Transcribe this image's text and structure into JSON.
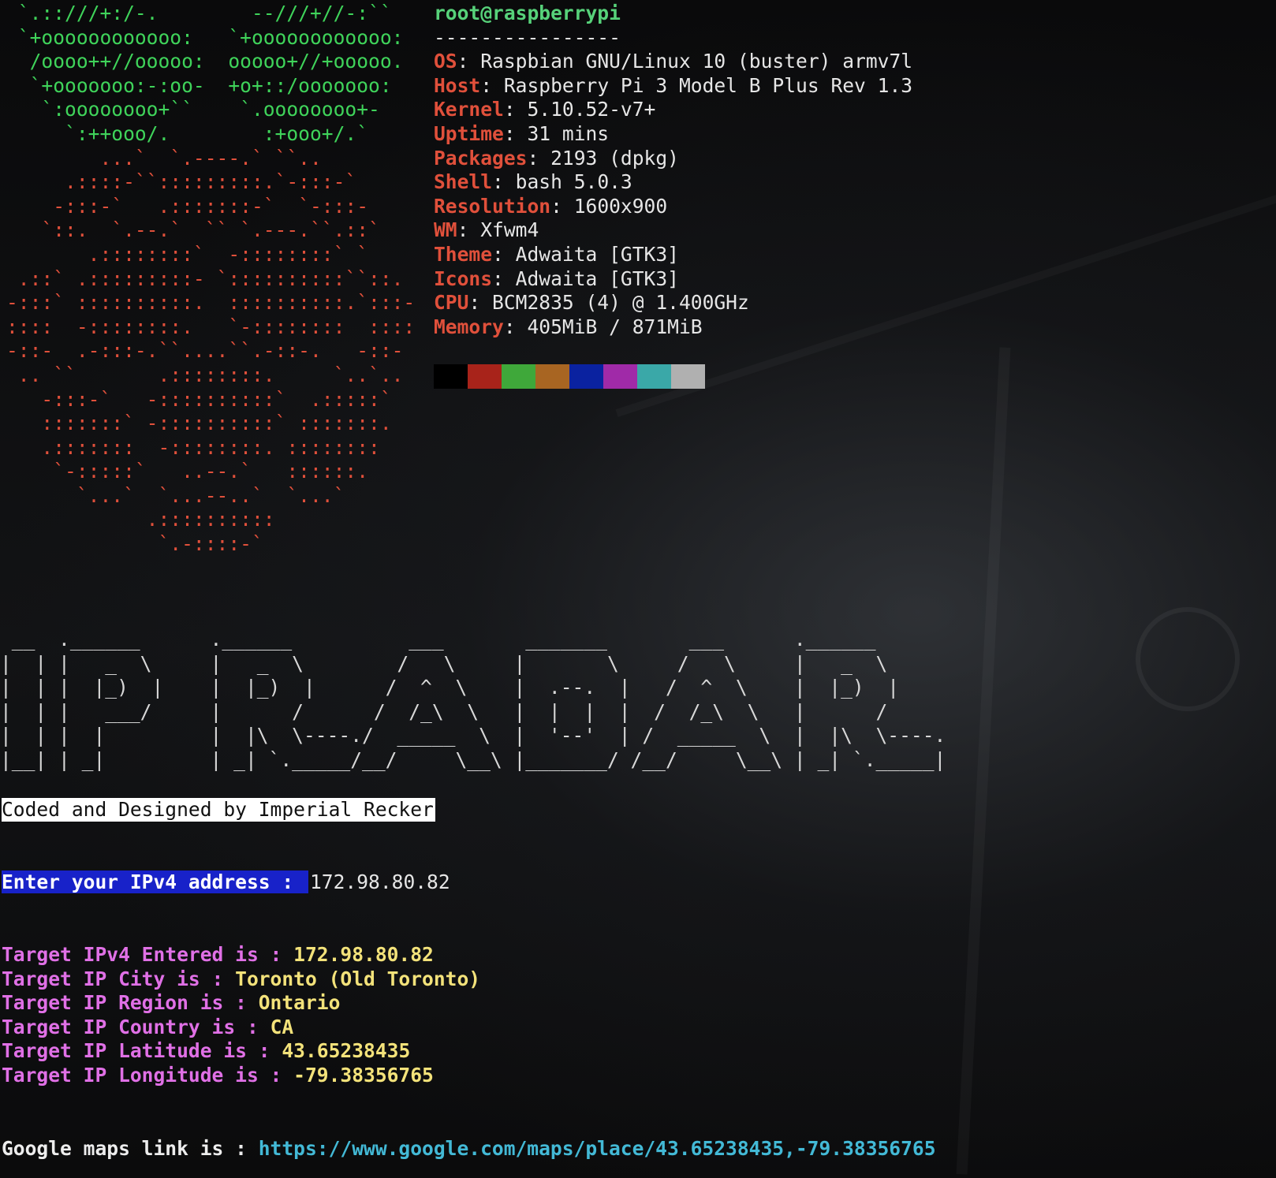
{
  "colors": {
    "background": "#0b0b0c",
    "logo_green": "#3fd35a",
    "logo_red": "#e0503b",
    "info_key": "#e0503b",
    "user_host": "#57d27a",
    "prompt_bg": "#1822c9",
    "result_label": "#e070e6",
    "result_value": "#f3e27a",
    "link": "#43b9d6"
  },
  "neofetch": {
    "logo_leaves": " `.::///+:/-.        --///+//-:``\n `+oooooooooooo:   `+oooooooooooo:\n  /oooo++//ooooo:  ooooo+//+ooooo.\n  `+ooooooo:-:oo-  +o+::/ooooooo:\n   `:oooooooo+``    `.oooooooo+-\n     `:++ooo/.        :+ooo+/.`",
    "logo_berry": "        ...`  `.----.` ``..\n     .::::-``:::::::::.`-:::-`\n    -:::-`   .:::::::-`  `-:::-\n   `::.  `.--.`  `` `.---.``.::`\n       .::::::::`  -::::::::` `\n .::` .:::::::::- `::::::::::``::.\n-:::` ::::::::::.  ::::::::::.`:::-\n::::  -::::::::.   `-::::::::  ::::\n-::-  .-:::-.``....``.-::-.   -::-\n .. ``       .::::::::.     `..`..\n   -:::-`   -::::::::::`  .:::::`\n   :::::::` -::::::::::` :::::::.\n   .:::::::  -::::::::. ::::::::\n    `-:::::`   ..--.`   ::::::.\n      `...`  `...--..`  `...`\n            .::::::::::\n             `.-::::-`",
    "user_host": "root@raspberrypi",
    "separator": "----------------",
    "fields": [
      {
        "key": "OS",
        "value": "Raspbian GNU/Linux 10 (buster) armv7l"
      },
      {
        "key": "Host",
        "value": "Raspberry Pi 3 Model B Plus Rev 1.3"
      },
      {
        "key": "Kernel",
        "value": "5.10.52-v7+"
      },
      {
        "key": "Uptime",
        "value": "31 mins"
      },
      {
        "key": "Packages",
        "value": "2193 (dpkg)"
      },
      {
        "key": "Shell",
        "value": "bash 5.0.3"
      },
      {
        "key": "Resolution",
        "value": "1600x900"
      },
      {
        "key": "WM",
        "value": "Xfwm4"
      },
      {
        "key": "Theme",
        "value": "Adwaita [GTK3]"
      },
      {
        "key": "Icons",
        "value": "Adwaita [GTK3]"
      },
      {
        "key": "CPU",
        "value": "BCM2835 (4) @ 1.400GHz"
      },
      {
        "key": "Memory",
        "value": "405MiB / 871MiB"
      }
    ],
    "palette": [
      "#000000",
      "#a8231a",
      "#3fa83a",
      "#a86522",
      "#0a22a0",
      "#a02aa8",
      "#3aa8a8",
      "#b0b0b0"
    ]
  },
  "banner": {
    "art": " __  .______      .______          ___       _______       ___      .______\n|  | |   _  \\     |   _  \\        /   \\     |       \\     /   \\     |   _  \\\n|  | |  |_)  |    |  |_)  |      /  ^  \\    |  .--.  |   /  ^  \\    |  |_)  |\n|  | |   ___/     |      /      /  /_\\  \\   |  |  |  |  /  /_\\  \\   |      /\n|  | |  |         |  |\\  \\----./  _____  \\  |  '--'  | /  _____  \\  |  |\\  \\----.\n|__| | _|         | _| `._____/__/     \\__\\ |_______/ /__/     \\__\\ | _| `._____|"
  },
  "credit": "Coded and Designed by Imperial Recker",
  "prompt": {
    "label": "Enter your IPv4 address : ",
    "value": "172.98.80.82"
  },
  "results": [
    {
      "label": "Target IPv4 Entered is : ",
      "value": "172.98.80.82"
    },
    {
      "label": "Target IP City is : ",
      "value": "Toronto (Old Toronto)"
    },
    {
      "label": "Target IP Region is : ",
      "value": "Ontario"
    },
    {
      "label": "Target IP Country is : ",
      "value": "CA"
    },
    {
      "label": "Target IP Latitude is : ",
      "value": "43.65238435"
    },
    {
      "label": "Target IP Longitude is : ",
      "value": "-79.38356765"
    }
  ],
  "maps": {
    "label": "Google maps link is : ",
    "url": "https://www.google.com/maps/place/43.65238435,-79.38356765"
  }
}
